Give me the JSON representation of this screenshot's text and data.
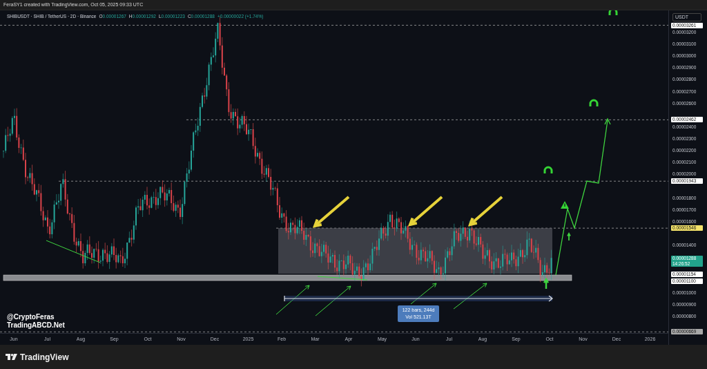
{
  "caption": "FeraSY1 created with TradingView.com, Oct 05, 2025 09:33 UTC",
  "legend": {
    "symbol": "SHIBUSDT · SHIB / TetherUS · 2D · Binance",
    "values": [
      {
        "label": "O",
        "value": "0.00001267"
      },
      {
        "label": "H",
        "value": "0.00001292"
      },
      {
        "label": "L",
        "value": "0.00001223"
      },
      {
        "label": "C",
        "value": "0.00001288"
      }
    ],
    "change": "+0.00000022 (+1.74%)"
  },
  "price_axis": {
    "currency": "USDT",
    "ticks": [
      "0.00003200",
      "0.00003100",
      "0.00003000",
      "0.00002900",
      "0.00002800",
      "0.00002700",
      "0.00002600",
      "0.00002400",
      "0.00002300",
      "0.00002200",
      "0.00002100",
      "0.00002000",
      "0.00001800",
      "0.00001700",
      "0.00001600",
      "0.00001400",
      "0.00001000",
      "0.00000900",
      "0.00000800"
    ],
    "markers": [
      {
        "value": "0.00003261",
        "color": "#ffffff"
      },
      {
        "value": "0.00002462",
        "color": "#ffffff"
      },
      {
        "value": "0.00001943",
        "color": "#ffffff"
      },
      {
        "value": "0.00001546",
        "color": "#f3e26a"
      },
      {
        "value": "0.00001288",
        "color": "#22a38b",
        "countdown": "14:26:52"
      },
      {
        "value": "0.00001154",
        "color": "#ffffff"
      },
      {
        "value": "0.00001100",
        "color": "#ffffff"
      },
      {
        "value": "0.00000669",
        "color": "#a8a8a8"
      }
    ]
  },
  "time_axis": {
    "labels": [
      "Jun",
      "Jul",
      "Aug",
      "Sep",
      "Oct",
      "Nov",
      "Dec",
      "2025",
      "Feb",
      "Mar",
      "Apr",
      "May",
      "Jun",
      "Jul",
      "Aug",
      "Sep",
      "Oct",
      "Nov",
      "Dec",
      "2026"
    ]
  },
  "annotations": {
    "author": [
      "@CryptoFeras",
      "TradingABCD.Net"
    ],
    "measure": [
      "122 bars, 244d",
      "Vol 521.13T"
    ]
  },
  "footer": {
    "brand": "TradingView"
  }
}
